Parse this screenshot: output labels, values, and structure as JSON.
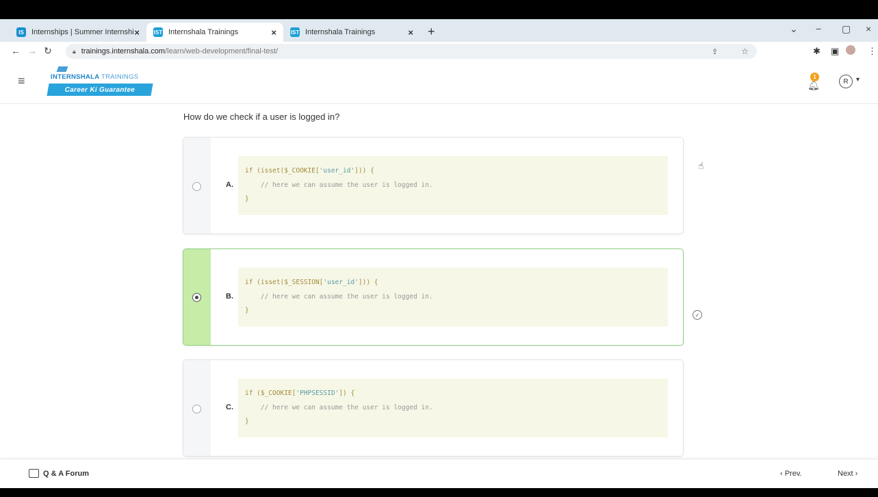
{
  "browser": {
    "tabs": [
      {
        "favicon": "IS",
        "title": "Internships | Summer Internship",
        "close": "×",
        "active": false
      },
      {
        "favicon": "IST",
        "title": "Internshala Trainings",
        "close": "×",
        "active": true
      },
      {
        "favicon": "IST",
        "title": "Internshala Trainings",
        "close": "×",
        "active": false
      }
    ],
    "new_tab": "+",
    "url_host": "trainings.internshala.com",
    "url_path": "/learn/web-development/final-test/",
    "window_controls": [
      "⌄",
      "−",
      "▢",
      "×"
    ]
  },
  "header": {
    "brand_bold": "INTERNSHALA",
    "brand_light": "TRAININGS",
    "tagline": "Career Ki Guarantee",
    "notification_count": "1",
    "avatar_initial": "R"
  },
  "quiz": {
    "question": "How do we check if a user is logged in?",
    "options": [
      {
        "letter": "A.",
        "selected": false,
        "code_open": "if (isset($_COOKIE[",
        "code_str": "'user_id'",
        "code_close": "])) {",
        "comment": "    // here we can assume the user is logged in.",
        "end": "}"
      },
      {
        "letter": "B.",
        "selected": true,
        "code_open": "if (isset($_SESSION[",
        "code_str": "'user_id'",
        "code_close": "])) {",
        "comment": "    // here we can assume the user is logged in.",
        "end": "}"
      },
      {
        "letter": "C.",
        "selected": false,
        "code_open": "if ($_COOKIE[",
        "code_str": "'PHPSESSID'",
        "code_close": "]) {",
        "comment": "    // here we can assume the user is logged in.",
        "end": "}"
      }
    ]
  },
  "footer": {
    "forum": "Q & A Forum",
    "prev": "‹ Prev.",
    "next": "Next ›"
  },
  "colors": {
    "selected_side": "#c6eca8",
    "selected_border": "#8dcf82",
    "brand_blue": "#29a3dc",
    "code_bg": "#f6f7e6"
  }
}
